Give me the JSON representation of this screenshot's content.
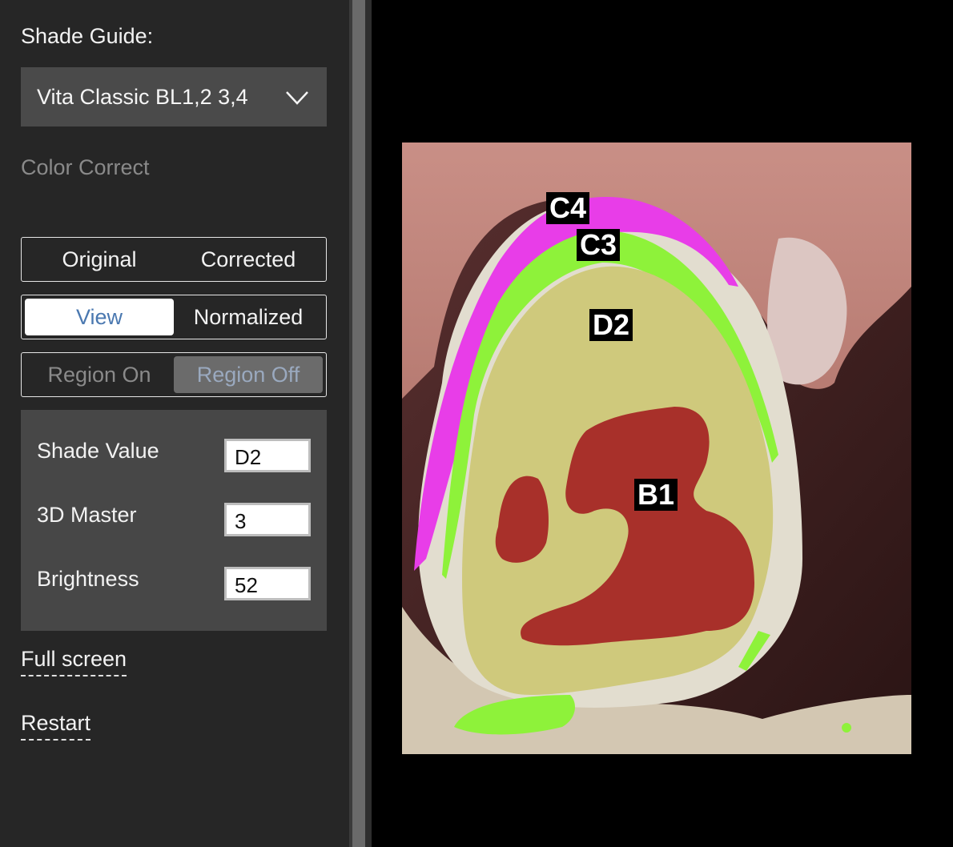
{
  "sidebar": {
    "shade_guide_label": "Shade Guide:",
    "shade_guide_value": "Vita Classic BL1,2 3,4",
    "color_correct_label": "Color Correct",
    "toggle_original_corrected": {
      "left": "Original",
      "right": "Corrected"
    },
    "toggle_view_normalized": {
      "left": "View",
      "right": "Normalized",
      "selected": "View"
    },
    "toggle_region": {
      "left": "Region On",
      "right": "Region Off",
      "selected": "Region Off"
    },
    "info": {
      "shade_value_label": "Shade Value",
      "shade_value": "D2",
      "master_3d_label": "3D Master",
      "master_3d_value": "3",
      "brightness_label": "Brightness",
      "brightness_value": "52"
    },
    "full_screen_link": "Full screen",
    "restart_link": "Restart"
  },
  "image": {
    "labels": {
      "c4": "C4",
      "c3": "C3",
      "d2": "D2",
      "b1": "B1"
    },
    "region_colors": {
      "C4": "#e83de8",
      "C3": "#8ef23a",
      "D2": "#cfc97c",
      "B1": "#a8302a"
    }
  }
}
